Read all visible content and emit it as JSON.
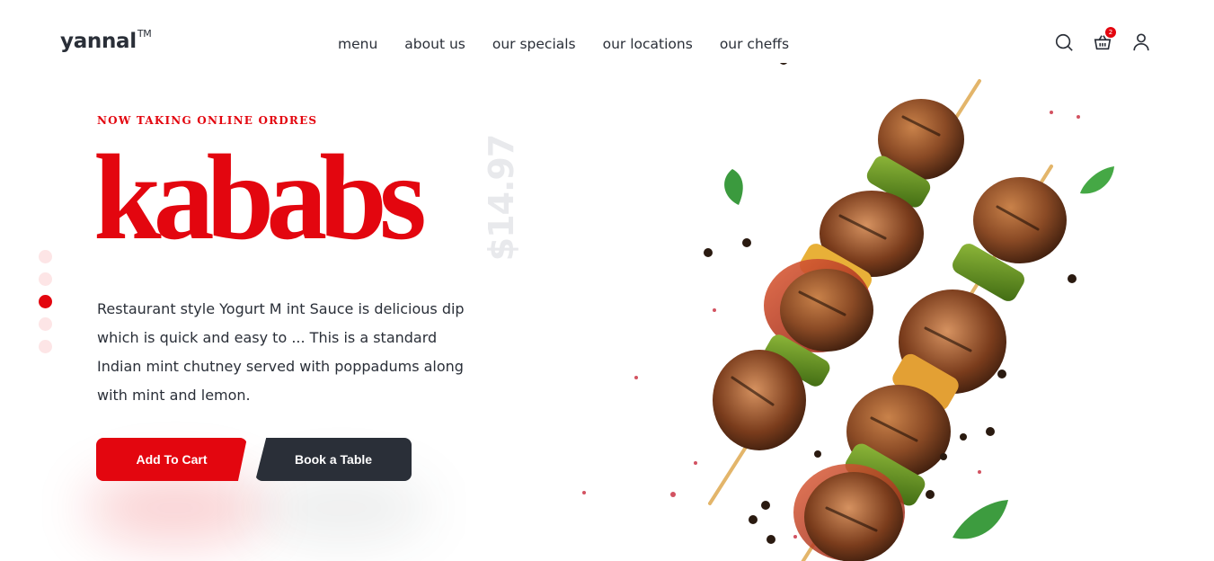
{
  "header": {
    "logo": "yannal",
    "logo_mark": "TM",
    "nav": [
      "menu",
      "about us",
      "our specials",
      "our locations",
      "our cheffs"
    ],
    "cart_count": "2",
    "icons": [
      "search-icon",
      "basket-icon",
      "user-icon"
    ]
  },
  "hero": {
    "eyebrow": "NOW TAKING ONLINE ORDRES",
    "title": "kababs",
    "price": "$14.97",
    "description": "Restaurant style Yogurt M int Sauce is delicious dip which is quick and easy to ... This is a standard Indian mint chutney served with poppadums along with mint and lemon.",
    "add_to_cart": "Add To Cart",
    "book_table": "Book a Table",
    "slider_dots": 5,
    "active_dot": 3
  },
  "colors": {
    "accent": "#e3060f",
    "dark": "#2a2f38",
    "price_ghost": "#e8e9ec",
    "dot_inactive": "#fde5e6"
  }
}
